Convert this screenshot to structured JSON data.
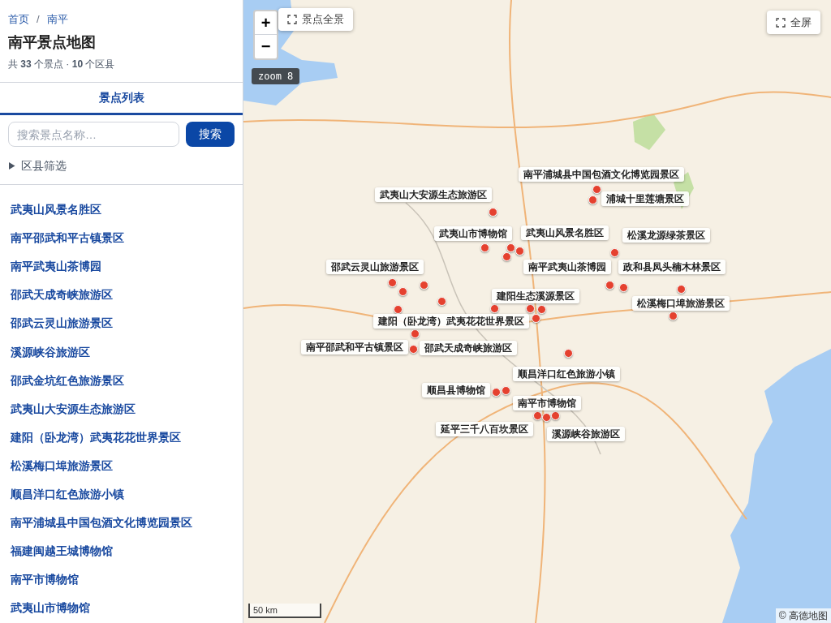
{
  "breadcrumb": {
    "items": [
      "首页",
      "南平"
    ],
    "separator": "/"
  },
  "title": "南平景点地图",
  "summary": "共 **33** 个景点 · **10** 个区县",
  "tabs": [
    {
      "label": "景点列表",
      "selected": true
    }
  ],
  "search": {
    "placeholder": "搜索景点名称…",
    "button": "搜索"
  },
  "filter": {
    "label": "区县筛选",
    "expanded": false
  },
  "spots": [
    "武夷山风景名胜区",
    "南平邵武和平古镇景区",
    "南平武夷山茶博园",
    "邵武天成奇峡旅游区",
    "邵武云灵山旅游景区",
    "溪源峡谷旅游区",
    "邵武金坑红色旅游景区",
    "武夷山大安源生态旅游区",
    "建阳（卧龙湾）武夷花花世界景区",
    "松溪梅口埠旅游景区",
    "顺昌洋口红色旅游小镇",
    "南平浦城县中国包酒文化博览园景区",
    "福建闽越王城博物馆",
    "南平市博物馆",
    "武夷山市博物馆"
  ],
  "map": {
    "zoom_in": "+",
    "zoom_out": "−",
    "overview_button": "景点全景",
    "fullscreen_button": "全屏",
    "zoom_badge": "zoom 8",
    "scale": "50 km",
    "attribution": "© 高德地图",
    "markers": [
      {
        "label": "南平浦城县中国包酒文化博览园景区"
      },
      {
        "label": "武夷山大安源生态旅游区"
      },
      {
        "label": "浦城十里莲塘景区"
      },
      {
        "label": "武夷山市博物馆"
      },
      {
        "label": "武夷山风景名胜区"
      },
      {
        "label": "松溪龙源绿茶景区"
      },
      {
        "label": "邵武云灵山旅游景区"
      },
      {
        "label": "南平武夷山茶博园"
      },
      {
        "label": "政和县凤头楠木林景区"
      },
      {
        "label": "建阳生态溪源景区"
      },
      {
        "label": "松溪梅口埠旅游景区"
      },
      {
        "label": "建阳（卧龙湾）武夷花花世界景区"
      },
      {
        "label": "南平邵武和平古镇景区"
      },
      {
        "label": "邵武天成奇峡旅游区"
      },
      {
        "label": "顺昌洋口红色旅游小镇"
      },
      {
        "label": "顺昌县博物馆"
      },
      {
        "label": "南平市博物馆"
      },
      {
        "label": "延平三千八百坎景区"
      },
      {
        "label": "溪源峡谷旅游区"
      }
    ]
  }
}
